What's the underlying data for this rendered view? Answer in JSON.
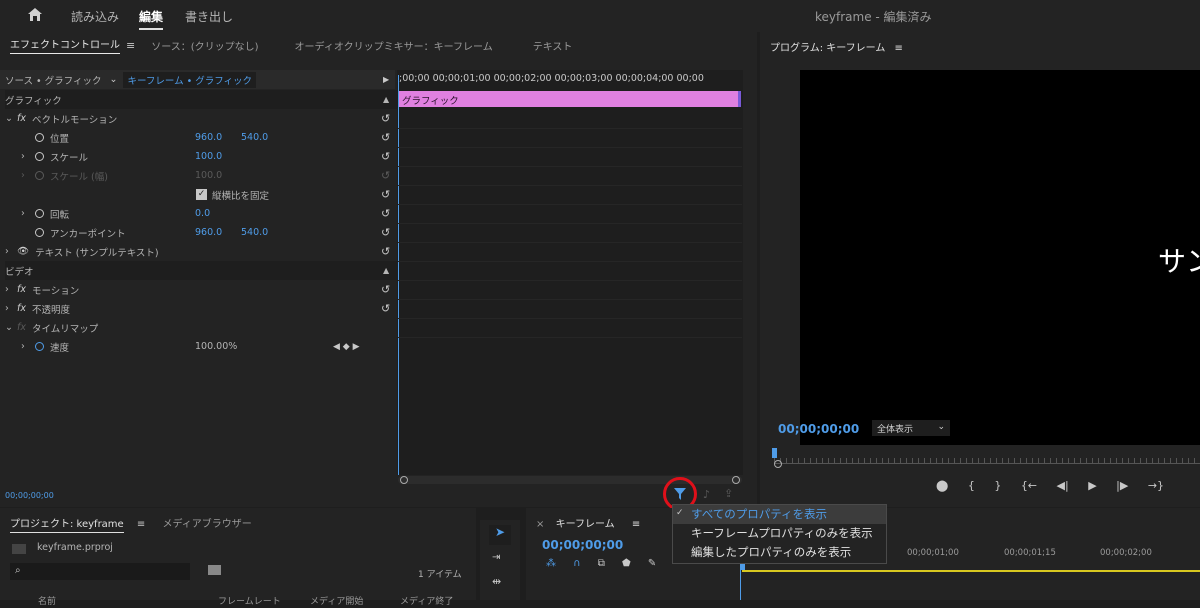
{
  "topbar": {
    "home_icon": "home-icon",
    "import": "読み込み",
    "edit": "編集",
    "export": "書き出し",
    "title": "keyframe - 編集済み"
  },
  "effect_panel": {
    "tabs": [
      "エフェクトコントロール",
      "ソース：(クリップなし)",
      "オーディオクリップミキサー：キーフレーム",
      "テキスト"
    ],
    "menu_glyph": "≡",
    "source_label": "ソース • グラフィック",
    "sequence_label": "キーフレーム • グラフィック",
    "timecodes": ";00;00 00;00;01;00 00;00;02;00 00;00;03;00 00;00;04;00 00;00",
    "clip_label": "グラフィック",
    "footer_timecode": "00;00;00;00",
    "rows": {
      "graphic": "グラフィック",
      "vector_motion": "ベクトルモーション",
      "position": "位置",
      "position_x": "960.0",
      "position_y": "540.0",
      "scale": "スケール",
      "scale_val": "100.0",
      "scale_width": "スケール (幅)",
      "scale_width_val": "100.0",
      "uniform": "縦横比を固定",
      "rotation": "回転",
      "rotation_val": "0.0",
      "anchor": "アンカーポイント",
      "anchor_x": "960.0",
      "anchor_y": "540.0",
      "text": "テキスト (サンプルテキスト)",
      "video": "ビデオ",
      "motion": "モーション",
      "opacity": "不透明度",
      "time_remap": "タイムリマップ",
      "speed": "速度",
      "speed_val": "100.00%",
      "fx": "fx"
    }
  },
  "program": {
    "title": "プログラム: キーフレーム",
    "menu_glyph": "≡",
    "timecode": "00;00;00;00",
    "zoom": "全体表示",
    "preview_text": "サン"
  },
  "project": {
    "tab": "プロジェクト: keyframe",
    "menu_glyph": "≡",
    "media_tab": "メディアブラウザー",
    "file": "keyframe.prproj",
    "count": "1 アイテム",
    "col1": "名前",
    "col2": "フレームレート",
    "col3": "メディア開始",
    "col4": "メディア終了"
  },
  "timeline": {
    "close": "×",
    "title": "キーフレーム",
    "menu_glyph": "≡",
    "timecode": "00;00;00;00",
    "ruler": [
      "00;00;01;00",
      "00;00;01;15",
      "00;00;02;00"
    ]
  },
  "dropdown": {
    "items": [
      "すべてのプロパティを表示",
      "キーフレームプロパティのみを表示",
      "編集したプロパティのみを表示"
    ]
  },
  "colors": {
    "accent": "#4f9ce8",
    "clip": "#e080e0",
    "highlight": "#e0101a"
  }
}
